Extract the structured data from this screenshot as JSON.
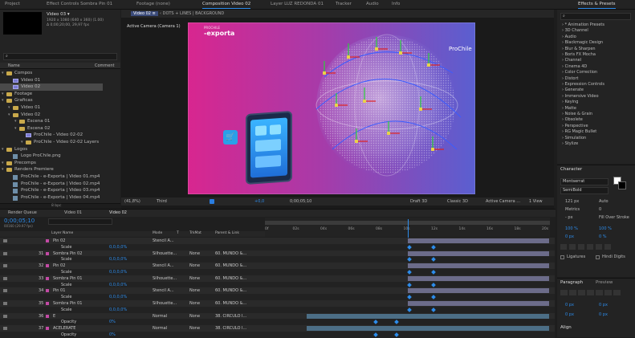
{
  "tabs_top": {
    "project": "Project",
    "effect_controls": "Effect Controls Sombra Pin 01",
    "footage": "Footage (none)",
    "composition": "Composition Video 02",
    "layer": "Layer LUZ REDONDA 01",
    "tracker": "Tracker",
    "audio": "Audio",
    "info": "Info",
    "effects_presets": "Effects & Presets"
  },
  "project": {
    "item_name": "Video 03 ▾",
    "item_line1": "1920 x 1080 (640 x 360) (1.00)",
    "item_line2": "Δ 0;00;20;00, 29,97 fps",
    "search_placeholder": "⌕",
    "col_name": "Name",
    "col_comment": "Comment",
    "items": [
      {
        "label": "Compos",
        "type": "folder",
        "indent": 0
      },
      {
        "label": "Video 01",
        "type": "comp",
        "indent": 1
      },
      {
        "label": "Video 02",
        "type": "comp",
        "indent": 1,
        "selected": true
      },
      {
        "label": "Footage",
        "type": "folder",
        "indent": 0
      },
      {
        "label": "Graficas",
        "type": "folder",
        "indent": 0
      },
      {
        "label": "Video 01",
        "type": "folder",
        "indent": 1
      },
      {
        "label": "Video 02",
        "type": "folder",
        "indent": 1
      },
      {
        "label": "Escena 01",
        "type": "folder",
        "indent": 2
      },
      {
        "label": "Escena 02",
        "type": "folder",
        "indent": 2
      },
      {
        "label": "ProChile - Video 02-02",
        "type": "comp",
        "indent": 3
      },
      {
        "label": "ProChile - Video 02-02 Layers",
        "type": "folder",
        "indent": 3
      },
      {
        "label": "Logos",
        "type": "folder",
        "indent": 0
      },
      {
        "label": "Logo ProChile.png",
        "type": "file",
        "indent": 1
      },
      {
        "label": "Precomps",
        "type": "folder",
        "indent": 0
      },
      {
        "label": "Renders Premiere",
        "type": "folder",
        "indent": 0
      },
      {
        "label": "ProChile - e-Exporta | Video 01.mp4",
        "type": "file",
        "indent": 1
      },
      {
        "label": "ProChile - e-Exporta | Video 02.mp4",
        "type": "file",
        "indent": 1
      },
      {
        "label": "ProChile - e-Exporta | Video 03.mp4",
        "type": "file",
        "indent": 1
      },
      {
        "label": "ProChile - e-Exporta | Video 04.mp4",
        "type": "file",
        "indent": 1
      }
    ],
    "bpc": "8 bpc"
  },
  "comp_viewer": {
    "subtab_active": "Video 02 ≡",
    "breadcrumb": "‹  DOTS + LINES | BACKGROUND",
    "camera_label": "Active Camera (Camera 1)",
    "logo_top": "PROCHILE",
    "logo_main": "-exporta",
    "prochile": "ProChile",
    "zoom": "(41,8%)",
    "quality": "Third",
    "exposure": "+0,0",
    "timecode": "0;00;05;10",
    "renderer": "Draft 3D",
    "renderer_mode": "Classic 3D",
    "camera_select": "Active Camera ...",
    "view_count": "1 View"
  },
  "effects": {
    "search_placeholder": "⌕",
    "items": [
      "* Animation Presets",
      "3D Channel",
      "Audio",
      "Blackmagic Design",
      "Blur & Sharpen",
      "Boris FX Mocha",
      "Channel",
      "Cinema 4D",
      "Color Correction",
      "Distort",
      "Expression Controls",
      "Generate",
      "Immersive Video",
      "Keying",
      "Matte",
      "Noise & Grain",
      "Obsolete",
      "Perspective",
      "RG Magic Bullet",
      "Simulation",
      "Stylize"
    ]
  },
  "character": {
    "title": "Character",
    "font": "Montserrat",
    "style": "SemiBold",
    "size": "121 px",
    "leading": "Auto",
    "tracking_metric": "Metrics",
    "tracking_val": "0",
    "stroke_px": "- px",
    "stroke_mode": "Fill Over Stroke",
    "vscale": "100 %",
    "hscale": "100 %",
    "baseline": "0 px",
    "tsume": "0 %",
    "ligatures": "Ligatures",
    "hindi": "Hindi Digits"
  },
  "paragraph": {
    "title": "Paragraph",
    "preview": "Preview",
    "indent1": "0 px",
    "indent2": "0 px",
    "space1": "0 px",
    "space2": "0 px",
    "align_title": "Align"
  },
  "timeline": {
    "tabs": [
      "Render Queue",
      "Video 01",
      "Video 02"
    ],
    "timecode": "0;00;05;10",
    "frames": "00160 (29.97 fps)",
    "col_layer": "Layer Name",
    "col_mode": "Mode",
    "col_t": "T",
    "col_trkmat": "TrkMat",
    "col_parent": "Parent & Link",
    "ruler": [
      "0f",
      "02s",
      "04s",
      "06s",
      "08s",
      "10s",
      "12s",
      "14s",
      "16s",
      "18s",
      "20s"
    ],
    "rows": [
      {
        "num": "",
        "name": "Pin 02",
        "mode": "Stencil A...",
        "trk": "",
        "parent": "",
        "kind": "layer"
      },
      {
        "num": "",
        "name": "Scale",
        "val": "0,0,0,0%",
        "kind": "prop"
      },
      {
        "num": "31",
        "name": "Sombra Pin 02",
        "mode": "Silhouette...",
        "trk": "None",
        "parent": "60. MUNDO &...",
        "kind": "layer"
      },
      {
        "num": "",
        "name": "Scale",
        "val": "0,0,0,0%",
        "kind": "prop"
      },
      {
        "num": "32",
        "name": "Pin 02",
        "mode": "Stencil A...",
        "trk": "None",
        "parent": "60. MUNDO &...",
        "kind": "layer"
      },
      {
        "num": "",
        "name": "Scale",
        "val": "0,0,0,0%",
        "kind": "prop"
      },
      {
        "num": "33",
        "name": "Sombra Pin 01",
        "mode": "Silhouette...",
        "trk": "None",
        "parent": "60. MUNDO &...",
        "kind": "layer"
      },
      {
        "num": "",
        "name": "Scale",
        "val": "0,0,0,0%",
        "kind": "prop"
      },
      {
        "num": "34",
        "name": "Pin 01",
        "mode": "Stencil A...",
        "trk": "None",
        "parent": "60. MUNDO &...",
        "kind": "layer"
      },
      {
        "num": "",
        "name": "Scale",
        "val": "0,0,0,0%",
        "kind": "prop"
      },
      {
        "num": "35",
        "name": "Sombra Pin 01",
        "mode": "Silhouette...",
        "trk": "None",
        "parent": "60. MUNDO &...",
        "kind": "layer"
      },
      {
        "num": "",
        "name": "Scale",
        "val": "0,0,0,0%",
        "kind": "prop"
      },
      {
        "num": "36",
        "name": "E",
        "mode": "Normal",
        "trk": "None",
        "parent": "38. CIRCULO I...",
        "kind": "layer"
      },
      {
        "num": "",
        "name": "Opacity",
        "val": "0%",
        "kind": "prop"
      },
      {
        "num": "37",
        "name": "ACELERATE",
        "mode": "Normal",
        "trk": "None",
        "parent": "38. CIRCULO I...",
        "kind": "layer"
      },
      {
        "num": "",
        "name": "Opacity",
        "val": "0%",
        "kind": "prop"
      }
    ]
  }
}
